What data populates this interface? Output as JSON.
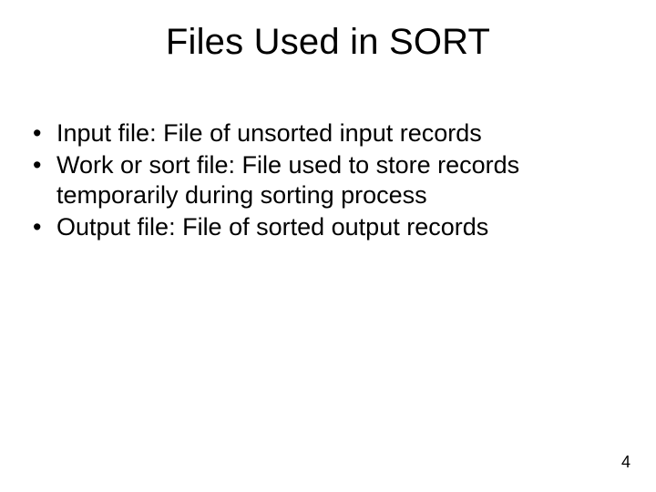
{
  "slide": {
    "title": "Files Used in SORT",
    "bullets": [
      "Input file: File of unsorted input records",
      "Work or sort file: File used to store records temporarily during sorting process",
      "Output file: File of sorted output records"
    ],
    "page_number": "4"
  }
}
